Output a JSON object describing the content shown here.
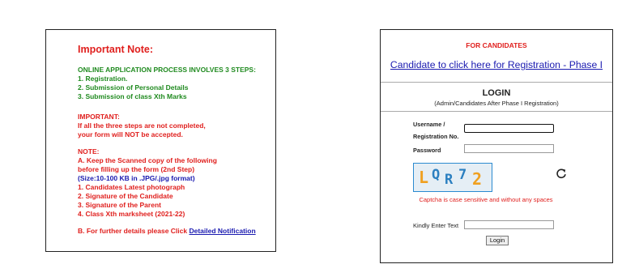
{
  "note": {
    "title": "Important Note:",
    "steps_heading": "ONLINE APPLICATION PROCESS INVOLVES 3 STEPS:",
    "steps": [
      "1. Registration.",
      "2. Submission of Personal Details",
      "3. Submission of class Xth Marks"
    ],
    "important_heading": "IMPORTANT:",
    "important_lines": [
      "If all the three steps are not completed,",
      "your form will NOT be accepted."
    ],
    "note_heading": "NOTE:",
    "note_lines": [
      "A. Keep the Scanned copy of the following",
      "before filling up the form (2nd Step)"
    ],
    "size_line": "(Size:10-100 KB in .JPG/.jpg format)",
    "docs": [
      "1. Candidates Latest photograph",
      "2. Signature of the Candidate",
      "3. Signature of the Parent",
      "4. Class Xth marksheet (2021-22)"
    ],
    "further_text": "B. For further details please Click",
    "further_link": "Detailed Notification"
  },
  "login": {
    "for_candidates": "FOR CANDIDATES",
    "registration_link": "Candidate to click here for Registration - Phase I",
    "title": "LOGIN",
    "subtitle": "(Admin/Candidates After Phase I Registration)",
    "username_label_1": "Username /",
    "username_label_2": "Registration No.",
    "username_value": "",
    "password_label": "Password",
    "password_value": "",
    "captcha_chars": [
      "L",
      "Q",
      "R",
      "7",
      "2"
    ],
    "captcha_note": "Captcha is case sensitive and without any spaces",
    "captcha_input_label": "Kindly Enter Text",
    "captcha_input_value": "",
    "login_button": "Login",
    "colors": {
      "captcha_blue": "#2b7fc0",
      "captcha_orange": "#f0a020",
      "note_red": "#e0201e",
      "note_green": "#1f8a1f",
      "link_blue": "#1a1ab0"
    },
    "refresh_icon": "refresh-icon"
  }
}
